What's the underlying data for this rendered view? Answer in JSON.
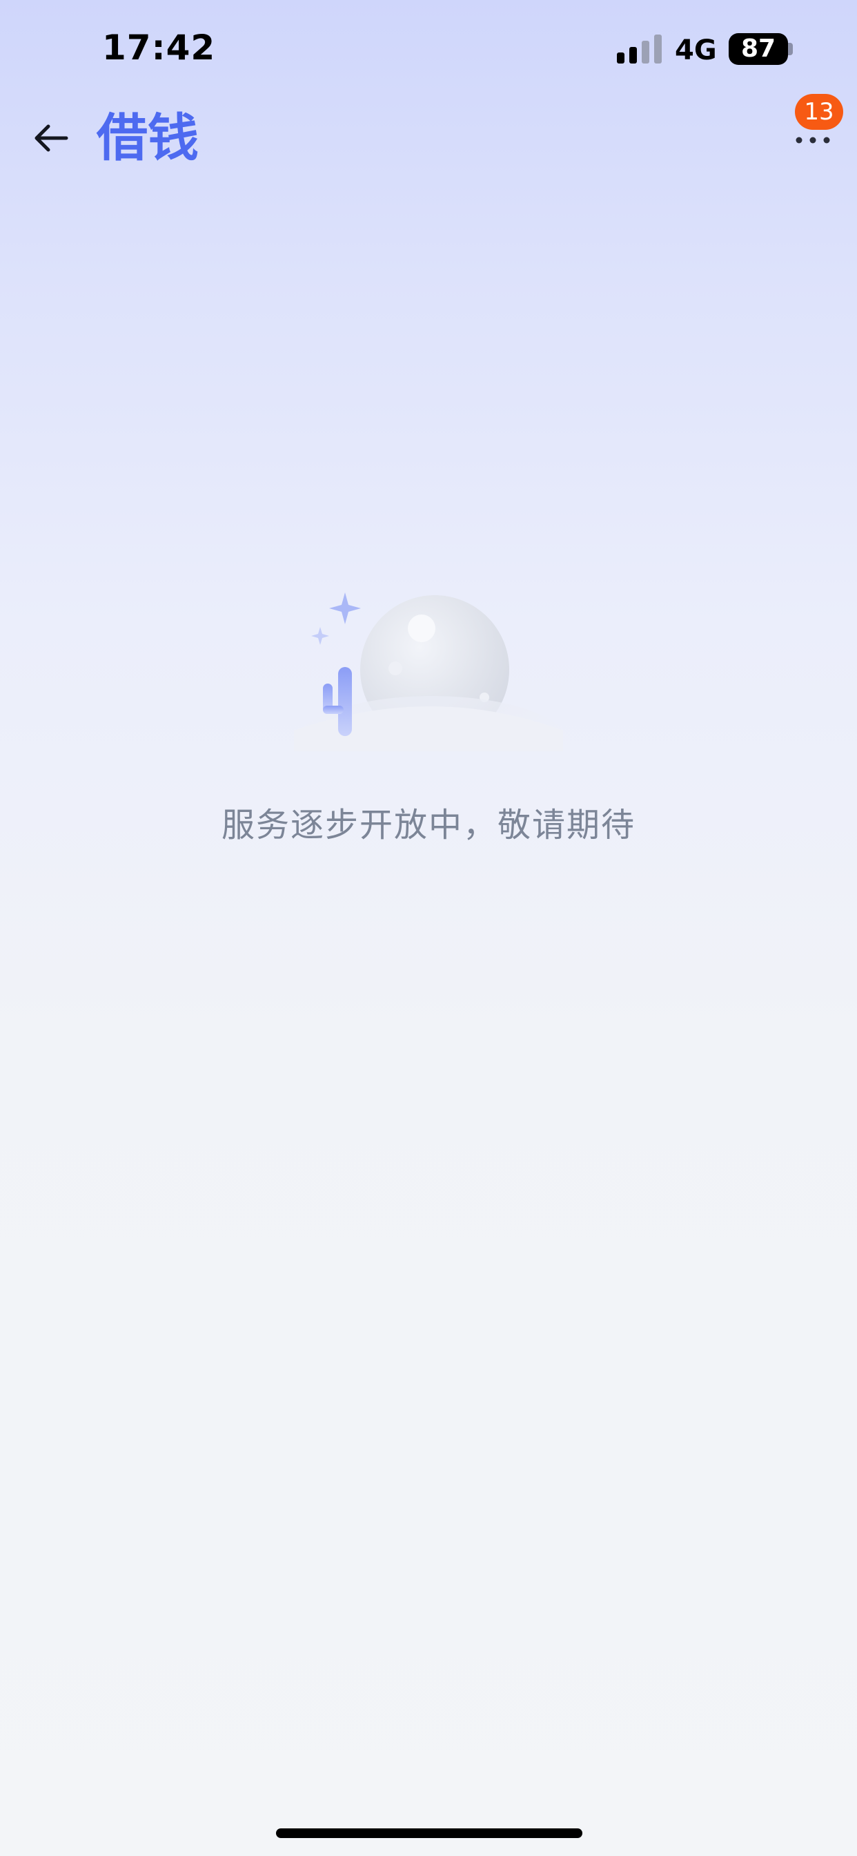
{
  "status_bar": {
    "time": "17:42",
    "network": "4G",
    "battery": "87"
  },
  "nav": {
    "title": "借钱",
    "badge_count": "13"
  },
  "empty_state": {
    "message": "服务逐步开放中，敬请期待"
  },
  "colors": {
    "accent": "#4d6af0",
    "badge": "#f75a13",
    "message": "#7c8597"
  },
  "icons": {
    "back": "arrow-left-icon",
    "more": "more-dots-icon",
    "signal": "cellular-signal-icon",
    "battery": "battery-icon",
    "illustration": "moon-cactus-empty-illustration"
  }
}
